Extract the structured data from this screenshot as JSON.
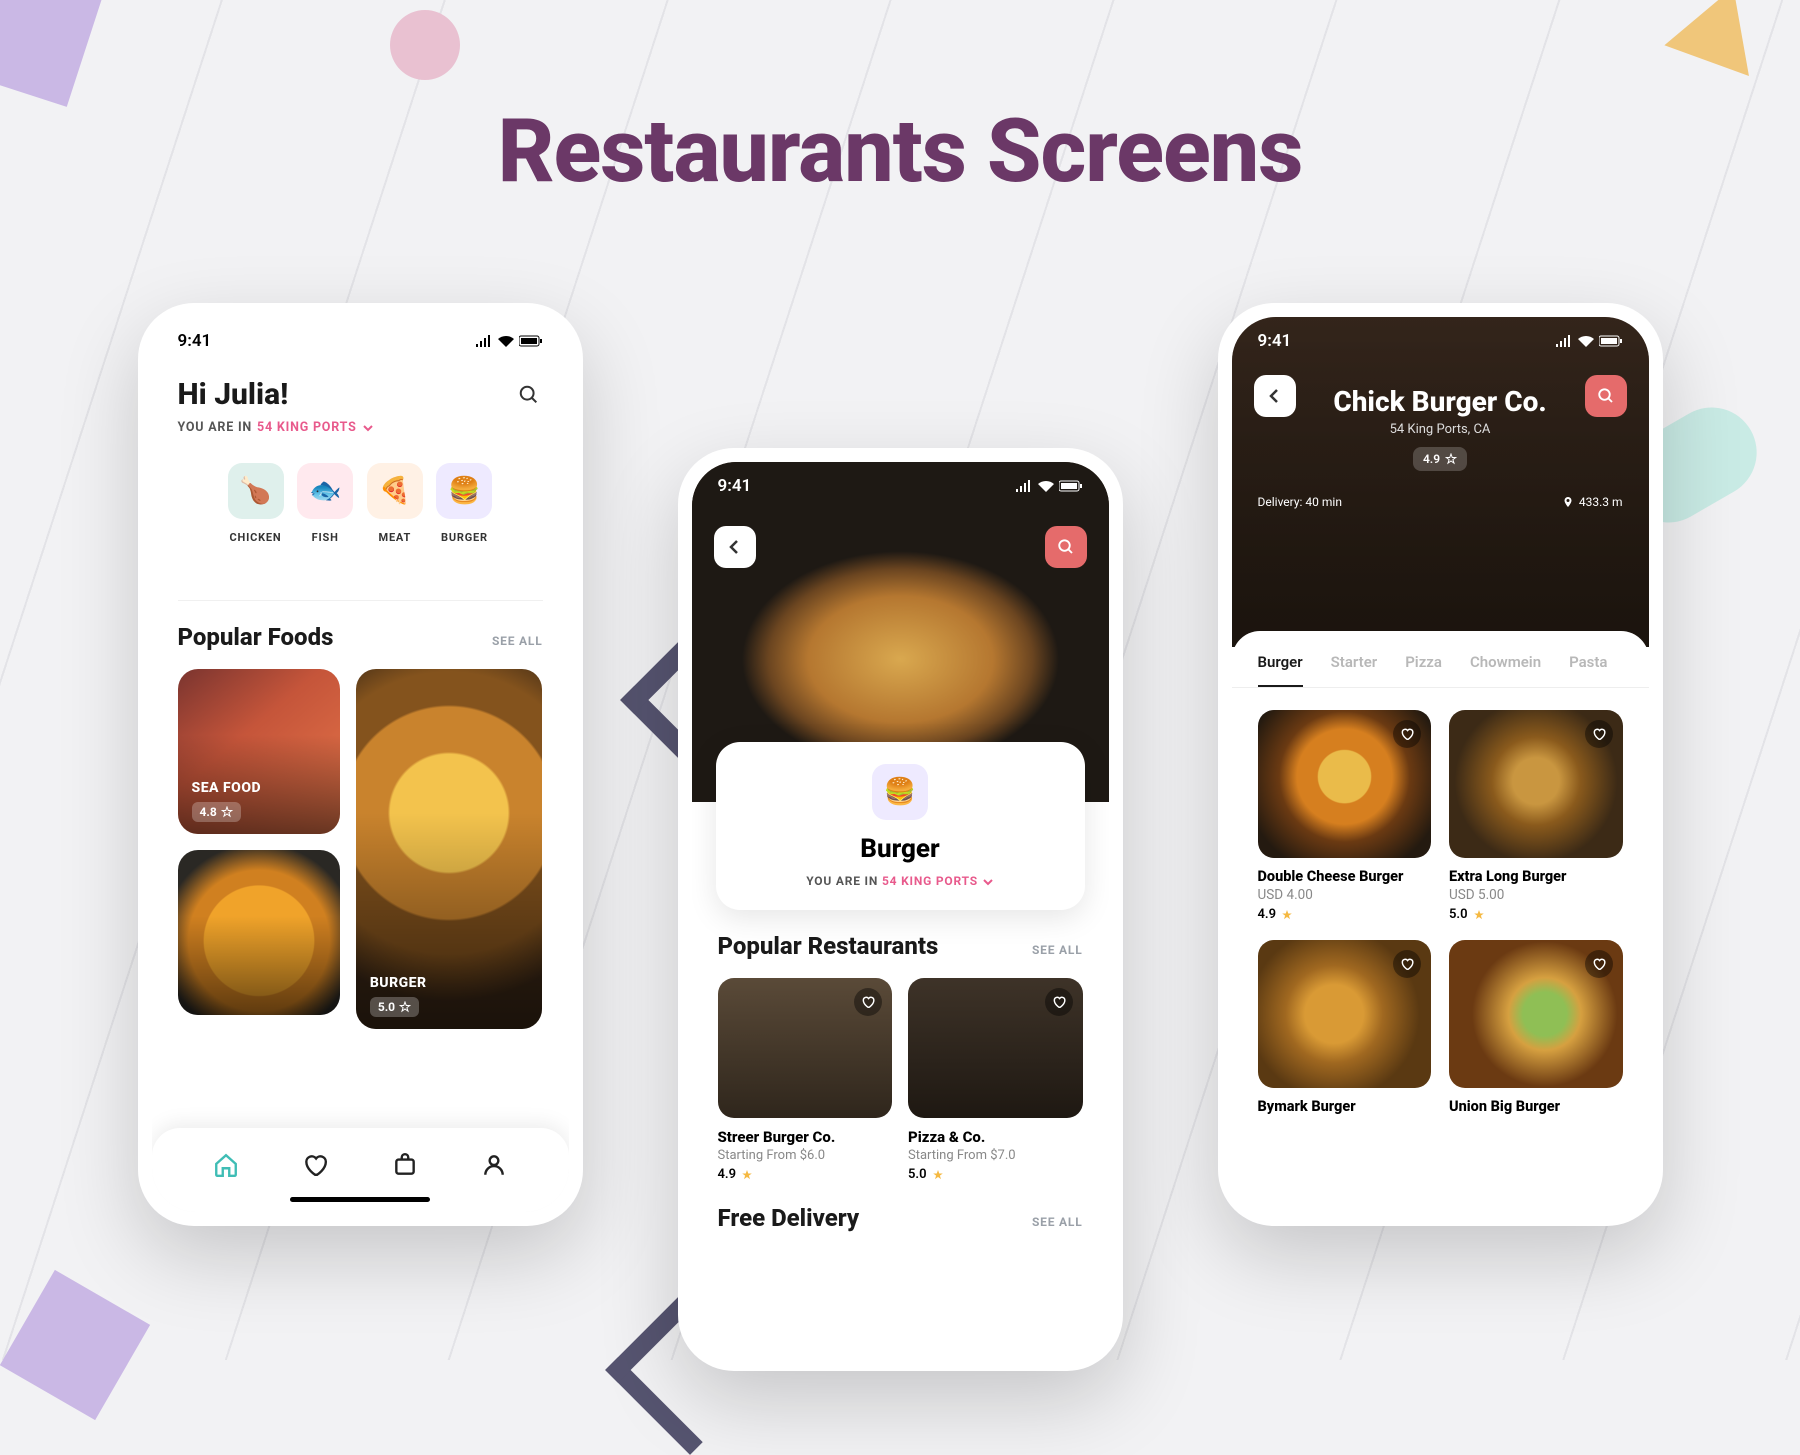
{
  "page_title": "Restaurants Screens",
  "status_time": "9:41",
  "phone1": {
    "greeting": "Hi Julia!",
    "location_prefix": "YOU ARE IN",
    "location": "54 KING PORTS",
    "categories": [
      {
        "label": "CHICKEN",
        "icon": "🍗",
        "bg": "#dff0ec"
      },
      {
        "label": "FISH",
        "icon": "🐟",
        "bg": "#ffe9ee"
      },
      {
        "label": "MEAT",
        "icon": "🍕",
        "bg": "#fff1e5"
      },
      {
        "label": "BURGER",
        "icon": "🍔",
        "bg": "#eeeaff"
      }
    ],
    "section_title": "Popular Foods",
    "see_all": "SEE ALL",
    "foods": [
      {
        "name": "SEA FOOD",
        "rating": "4.8"
      },
      {
        "name": "BURGER",
        "rating": "5.0"
      }
    ]
  },
  "phone2": {
    "card_title": "Burger",
    "location_prefix": "YOU ARE IN",
    "location": "54 KING PORTS",
    "section1": "Popular Restaurants",
    "section2": "Free Delivery",
    "see_all": "SEE ALL",
    "restaurants": [
      {
        "name": "Streer Burger Co.",
        "sub": "Starting From $6.0",
        "rating": "4.9"
      },
      {
        "name": "Pizza & Co.",
        "sub": "Starting From $7.0",
        "rating": "5.0"
      }
    ]
  },
  "phone3": {
    "title": "Chick Burger Co.",
    "subtitle": "54 King Ports, CA",
    "rating": "4.9",
    "delivery": "Delivery: 40 min",
    "distance": "433.3 m",
    "tabs": [
      "Burger",
      "Starter",
      "Pizza",
      "Chowmein",
      "Pasta"
    ],
    "products": [
      {
        "name": "Double Cheese Burger",
        "price": "USD 4.00",
        "rating": "4.9"
      },
      {
        "name": "Extra Long Burger",
        "price": "USD 5.00",
        "rating": "5.0"
      },
      {
        "name": "Bymark Burger"
      },
      {
        "name": "Union Big Burger"
      }
    ]
  }
}
